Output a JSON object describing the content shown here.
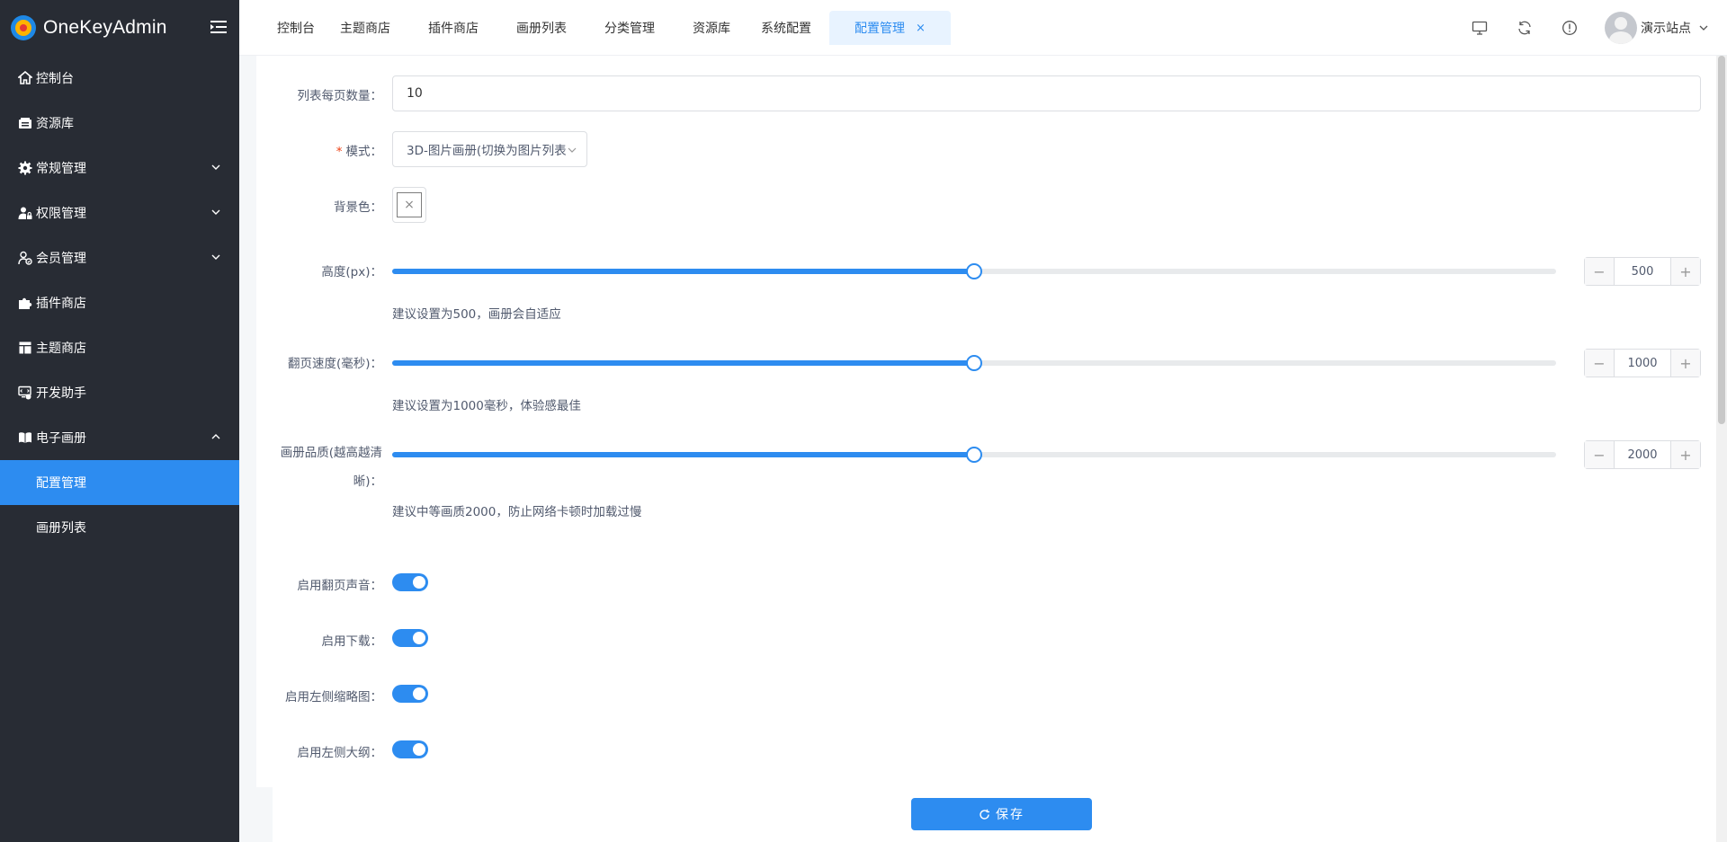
{
  "app": {
    "name": "OneKeyAdmin"
  },
  "sidebar": {
    "items": [
      {
        "label": "控制台",
        "icon": "home-icon"
      },
      {
        "label": "资源库",
        "icon": "storage-icon"
      },
      {
        "label": "常规管理",
        "icon": "gear-icon",
        "expandable": true
      },
      {
        "label": "权限管理",
        "icon": "user-lock-icon",
        "expandable": true
      },
      {
        "label": "会员管理",
        "icon": "member-icon",
        "expandable": true
      },
      {
        "label": "插件商店",
        "icon": "puzzle-icon"
      },
      {
        "label": "主题商店",
        "icon": "layout-icon"
      },
      {
        "label": "开发助手",
        "icon": "dev-icon"
      },
      {
        "label": "电子画册",
        "icon": "book-icon",
        "expanded": true
      }
    ],
    "submenu": [
      {
        "label": "配置管理",
        "active": true
      },
      {
        "label": "画册列表",
        "active": false
      }
    ]
  },
  "header": {
    "tabs": [
      {
        "label": "控制台"
      },
      {
        "label": "主题商店"
      },
      {
        "label": "插件商店"
      },
      {
        "label": "画册列表"
      },
      {
        "label": "分类管理"
      },
      {
        "label": "资源库"
      },
      {
        "label": "系统配置"
      },
      {
        "label": "配置管理",
        "active": true,
        "close": "×"
      }
    ],
    "icons": [
      "monitor-icon",
      "refresh-icon",
      "info-icon"
    ],
    "user": {
      "name": "演示站点"
    }
  },
  "form": {
    "page_size": {
      "label": "列表每页数量：",
      "value": "10"
    },
    "mode": {
      "label": "模式：",
      "required": "*",
      "value": "3D-图片画册(切换为图片列表"
    },
    "background": {
      "label": "背景色：",
      "empty_mark": "×"
    },
    "height": {
      "label": "高度(px)：",
      "value": "500",
      "fraction": 0.5,
      "hint": "建议设置为500，画册会自适应"
    },
    "speed": {
      "label": "翻页速度(毫秒)：",
      "value": "1000",
      "fraction": 0.5,
      "hint": "建议设置为1000毫秒，体验感最佳"
    },
    "quality": {
      "label_line1": "画册品质(越高越清",
      "label_line2": "晰)：",
      "value": "2000",
      "fraction": 0.5,
      "hint": "建议中等画质2000，防止网络卡顿时加载过慢"
    },
    "toggles": [
      {
        "label": "启用翻页声音：",
        "on": true
      },
      {
        "label": "启用下载：",
        "on": true
      },
      {
        "label": "启用左侧缩略图：",
        "on": true
      },
      {
        "label": "启用左侧大纲：",
        "on": true
      }
    ],
    "stepper_minus": "−",
    "stepper_plus": "+",
    "save_label": "保存"
  },
  "colors": {
    "primary": "#2d8cf0",
    "sidebar_bg": "#282c34",
    "active_tab_bg": "#e8f3ff"
  }
}
